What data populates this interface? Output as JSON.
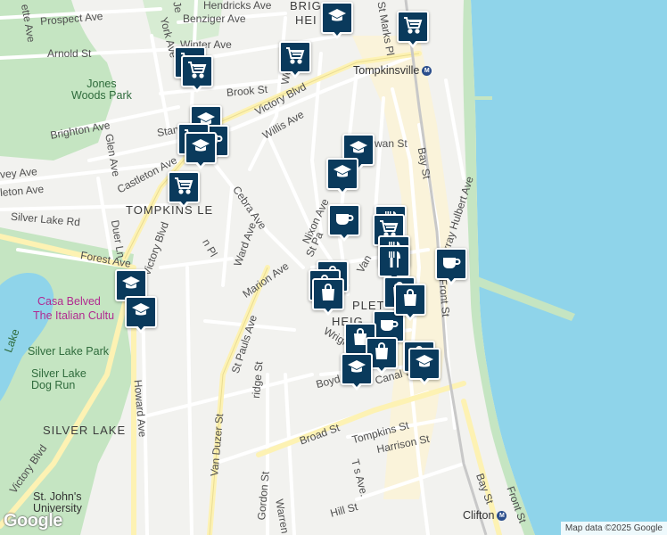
{
  "map": {
    "colors": {
      "water": "#8fd4ea",
      "land": "#f2f2ef",
      "park": "#c5e5c2",
      "road": "#ffffff",
      "major_road": "#fff3b5",
      "marker": "#0a3a5c",
      "poi": "#b12a90"
    },
    "attribution": "Map data ©2025 Google",
    "logo": "Google",
    "areas": [
      "TOMPKINSVILLE",
      "SILVER LAKE",
      "APPLETON HEIGHTS",
      "BRIGHTON HEIGHTS"
    ],
    "area_labels": {
      "tompkinsville": "TOMPKINS  LE",
      "silver_lake": "SILVER LAKE",
      "appleton": "PLET",
      "appleton2": "HEIG",
      "brighton1": "BRIG",
      "brighton2": "HEI"
    },
    "parks": {
      "jones_woods": "Jones\nWoods Park",
      "silver_lake_park": "Silver Lake Park",
      "dog_run": "Silver Lake\nDog Run",
      "lake": "Lake"
    },
    "pois": {
      "casa": "Casa Belved",
      "casa2": "The Italian Cultu",
      "st_johns": "St. John's\nUniversity"
    },
    "stations": {
      "tompkinsville": "Tompkinsville",
      "clifton": "Clifton"
    },
    "streets": {
      "prospect": "Prospect Ave",
      "benziger": "Benziger Ave",
      "hendricks": "Hendricks Ave",
      "winter": "Winter Ave",
      "arnold": "Arnold St",
      "york": "York Ave",
      "brook": "Brook St",
      "victory1": "Victory Blvd",
      "victory2": "Victory Blvd",
      "victory3": "Victory Blvd",
      "willis": "Willis Ave",
      "brighton": "Brighton Ave",
      "glen": "Glen Ave",
      "castleton": "Castleton Ave",
      "stanley": "Stan",
      "harvey": "vey Ave",
      "leton": "leton Ave",
      "silver_lake_rd": "Silver Lake Rd",
      "duer": "Duer Ln",
      "forest": "Forest Ave",
      "cebra": "Cebra Ave",
      "ward": "Ward Ave",
      "marion": "Marion Ave",
      "nixon": "Nixon Ave",
      "st_pauls1": "St Pa",
      "st_pauls2": "St Pauls Ave",
      "van": "Van",
      "bay1": "Bay St",
      "bay2": "Bay St",
      "murray": "Murray Hulbert Ave",
      "front1": "Front St",
      "front2": "Front St",
      "st_marks": "St Marks Pl",
      "howard": "Howard Ave",
      "van_duzer": "Van Duzer St",
      "gordon": "Gordon St",
      "warren": "Warren",
      "broad": "Broad St",
      "tompkins": "Tompkins St",
      "harrison": "Harrison St",
      "hill": "Hill St",
      "boyd": "Boyd St",
      "canal": "Canal St",
      "wright": "Wrigh",
      "ridge": "ridge St",
      "wall": "wan St",
      "lafayette": "ette Ave",
      "jersey": "Je",
      "wey": "We",
      "t_ave": "T  s Ave.",
      "victory4": "Victory Blvd",
      "elm": "n Pl"
    },
    "markers": [
      {
        "type": "school",
        "icon": "graduation-cap-icon"
      },
      {
        "type": "grocery",
        "icon": "shopping-cart-icon"
      },
      {
        "type": "grocery",
        "icon": "shopping-cart-icon"
      },
      {
        "type": "grocery",
        "icon": "shopping-cart-icon"
      },
      {
        "type": "grocery",
        "icon": "shopping-cart-icon"
      },
      {
        "type": "school",
        "icon": "graduation-cap-icon"
      },
      {
        "type": "cafe",
        "icon": "coffee-cup-icon"
      },
      {
        "type": "grocery",
        "icon": "shopping-cart-icon"
      },
      {
        "type": "school",
        "icon": "graduation-cap-icon"
      },
      {
        "type": "school",
        "icon": "graduation-cap-icon"
      },
      {
        "type": "grocery",
        "icon": "shopping-cart-icon"
      },
      {
        "type": "school",
        "icon": "graduation-cap-icon"
      },
      {
        "type": "cafe",
        "icon": "coffee-cup-icon"
      },
      {
        "type": "restaurant",
        "icon": "fork-knife-icon"
      },
      {
        "type": "grocery",
        "icon": "shopping-cart-icon"
      },
      {
        "type": "restaurant",
        "icon": "fork-knife-icon"
      },
      {
        "type": "restaurant",
        "icon": "fork-knife-icon"
      },
      {
        "type": "cafe",
        "icon": "coffee-cup-icon"
      },
      {
        "type": "school",
        "icon": "graduation-cap-icon"
      },
      {
        "type": "school",
        "icon": "graduation-cap-icon"
      },
      {
        "type": "store",
        "icon": "shopping-bag-icon"
      },
      {
        "type": "store",
        "icon": "shopping-bag-icon"
      },
      {
        "type": "store",
        "icon": "shopping-bag-icon"
      },
      {
        "type": "store",
        "icon": "shopping-bag-icon"
      },
      {
        "type": "cafe",
        "icon": "coffee-cup-icon"
      },
      {
        "type": "store",
        "icon": "shopping-bag-icon"
      },
      {
        "type": "store",
        "icon": "shopping-bag-icon"
      },
      {
        "type": "store",
        "icon": "shopping-bag-icon"
      },
      {
        "type": "store",
        "icon": "shopping-bag-icon"
      },
      {
        "type": "school",
        "icon": "graduation-cap-icon"
      },
      {
        "type": "school",
        "icon": "graduation-cap-icon"
      }
    ]
  }
}
